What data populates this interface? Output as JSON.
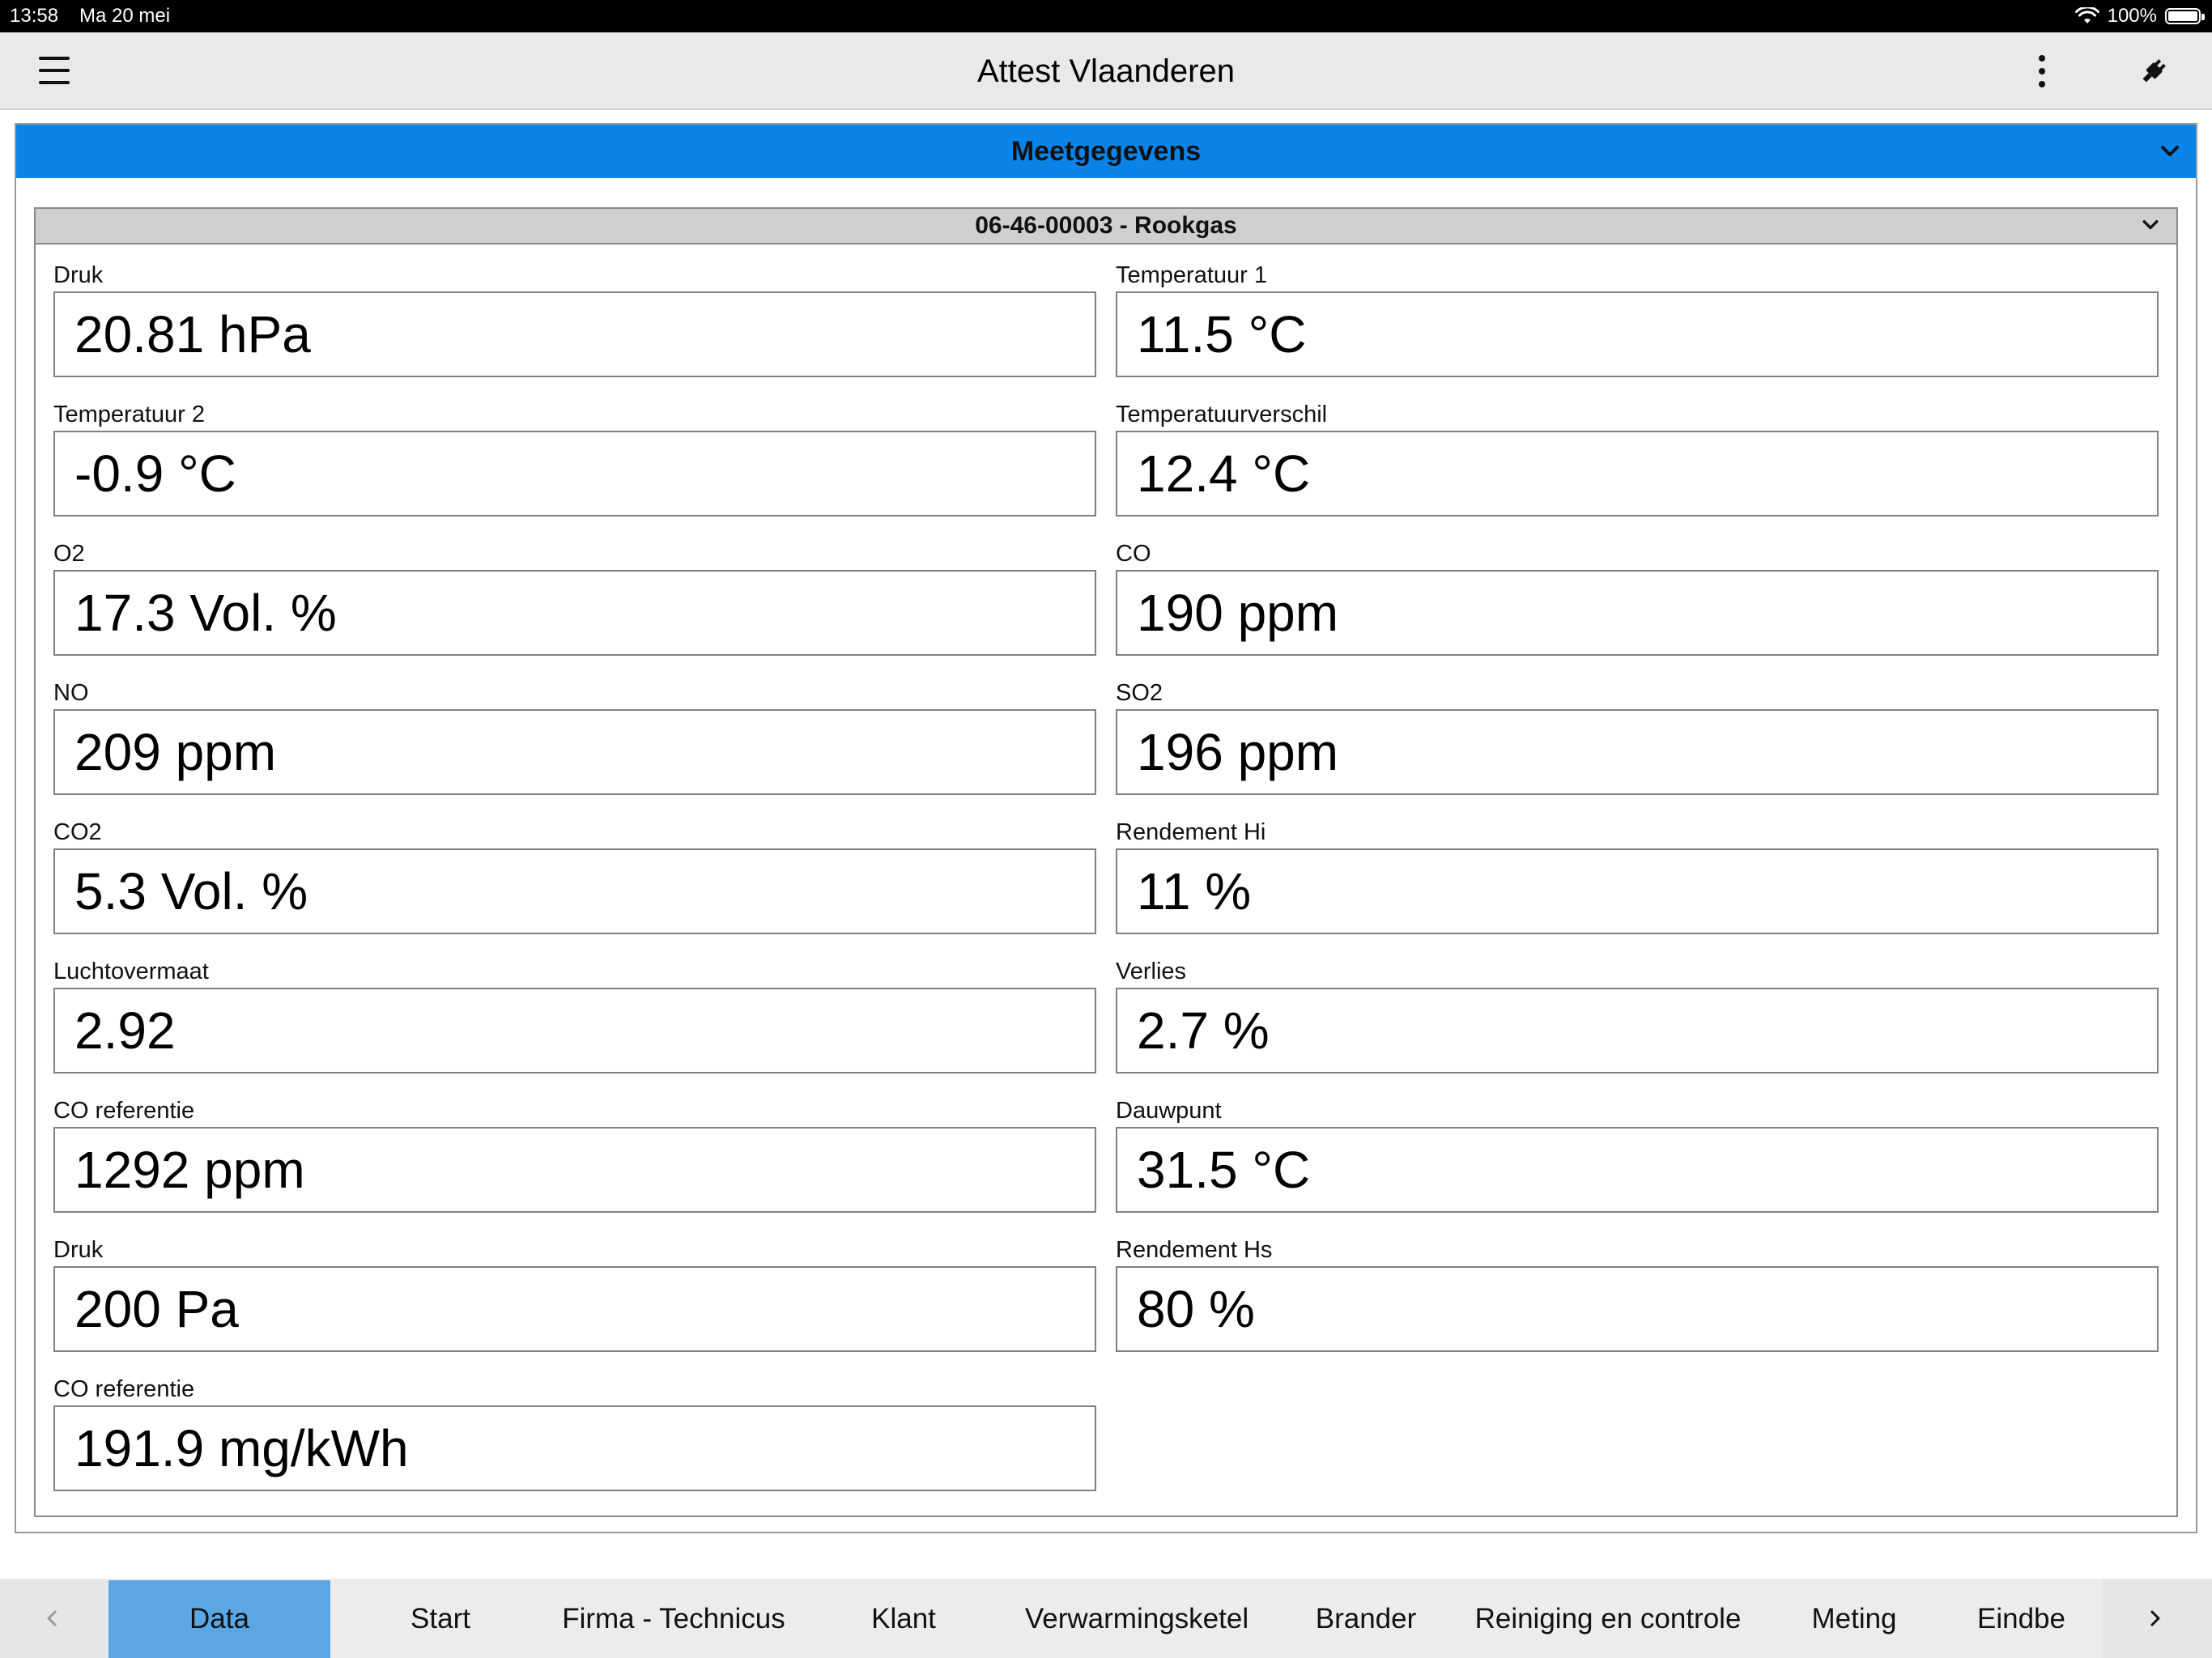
{
  "status_bar": {
    "time": "13:58",
    "date": "Ma 20 mei",
    "battery": "100%",
    "battery_level": 1.0
  },
  "app_bar": {
    "title": "Attest Vlaanderen"
  },
  "section": {
    "title": "Meetgegevens"
  },
  "subsection": {
    "title": "06-46-00003 - Rookgas"
  },
  "fields": [
    {
      "label": "Druk",
      "value": "20.81 hPa"
    },
    {
      "label": "Temperatuur 1",
      "value": "11.5 °C"
    },
    {
      "label": "Temperatuur 2",
      "value": "-0.9 °C"
    },
    {
      "label": "Temperatuurverschil",
      "value": "12.4 °C"
    },
    {
      "label": "O2",
      "value": "17.3 Vol. %"
    },
    {
      "label": "CO",
      "value": "190 ppm"
    },
    {
      "label": "NO",
      "value": "209 ppm"
    },
    {
      "label": "SO2",
      "value": "196 ppm"
    },
    {
      "label": "CO2",
      "value": "5.3 Vol. %"
    },
    {
      "label": "Rendement Hi",
      "value": "11 %"
    },
    {
      "label": "Luchtovermaat",
      "value": "2.92"
    },
    {
      "label": "Verlies",
      "value": "2.7 %"
    },
    {
      "label": "CO referentie",
      "value": "1292 ppm"
    },
    {
      "label": "Dauwpunt",
      "value": "31.5 °C"
    },
    {
      "label": "Druk",
      "value": "200 Pa"
    },
    {
      "label": "Rendement Hs",
      "value": "80 %"
    },
    {
      "label": "CO referentie",
      "value": "191.9 mg/kWh"
    }
  ],
  "tabs": [
    {
      "label": "Data",
      "active": true
    },
    {
      "label": "Start"
    },
    {
      "label": "Firma - Technicus"
    },
    {
      "label": "Klant"
    },
    {
      "label": "Verwarmingsketel"
    },
    {
      "label": "Brander"
    },
    {
      "label": "Reiniging en controle"
    },
    {
      "label": "Meting"
    },
    {
      "label": "Eindbe"
    }
  ],
  "colors": {
    "accent": "#0a84e8",
    "active_tab": "#5aa7e4",
    "subheader": "#cfcfcf"
  }
}
